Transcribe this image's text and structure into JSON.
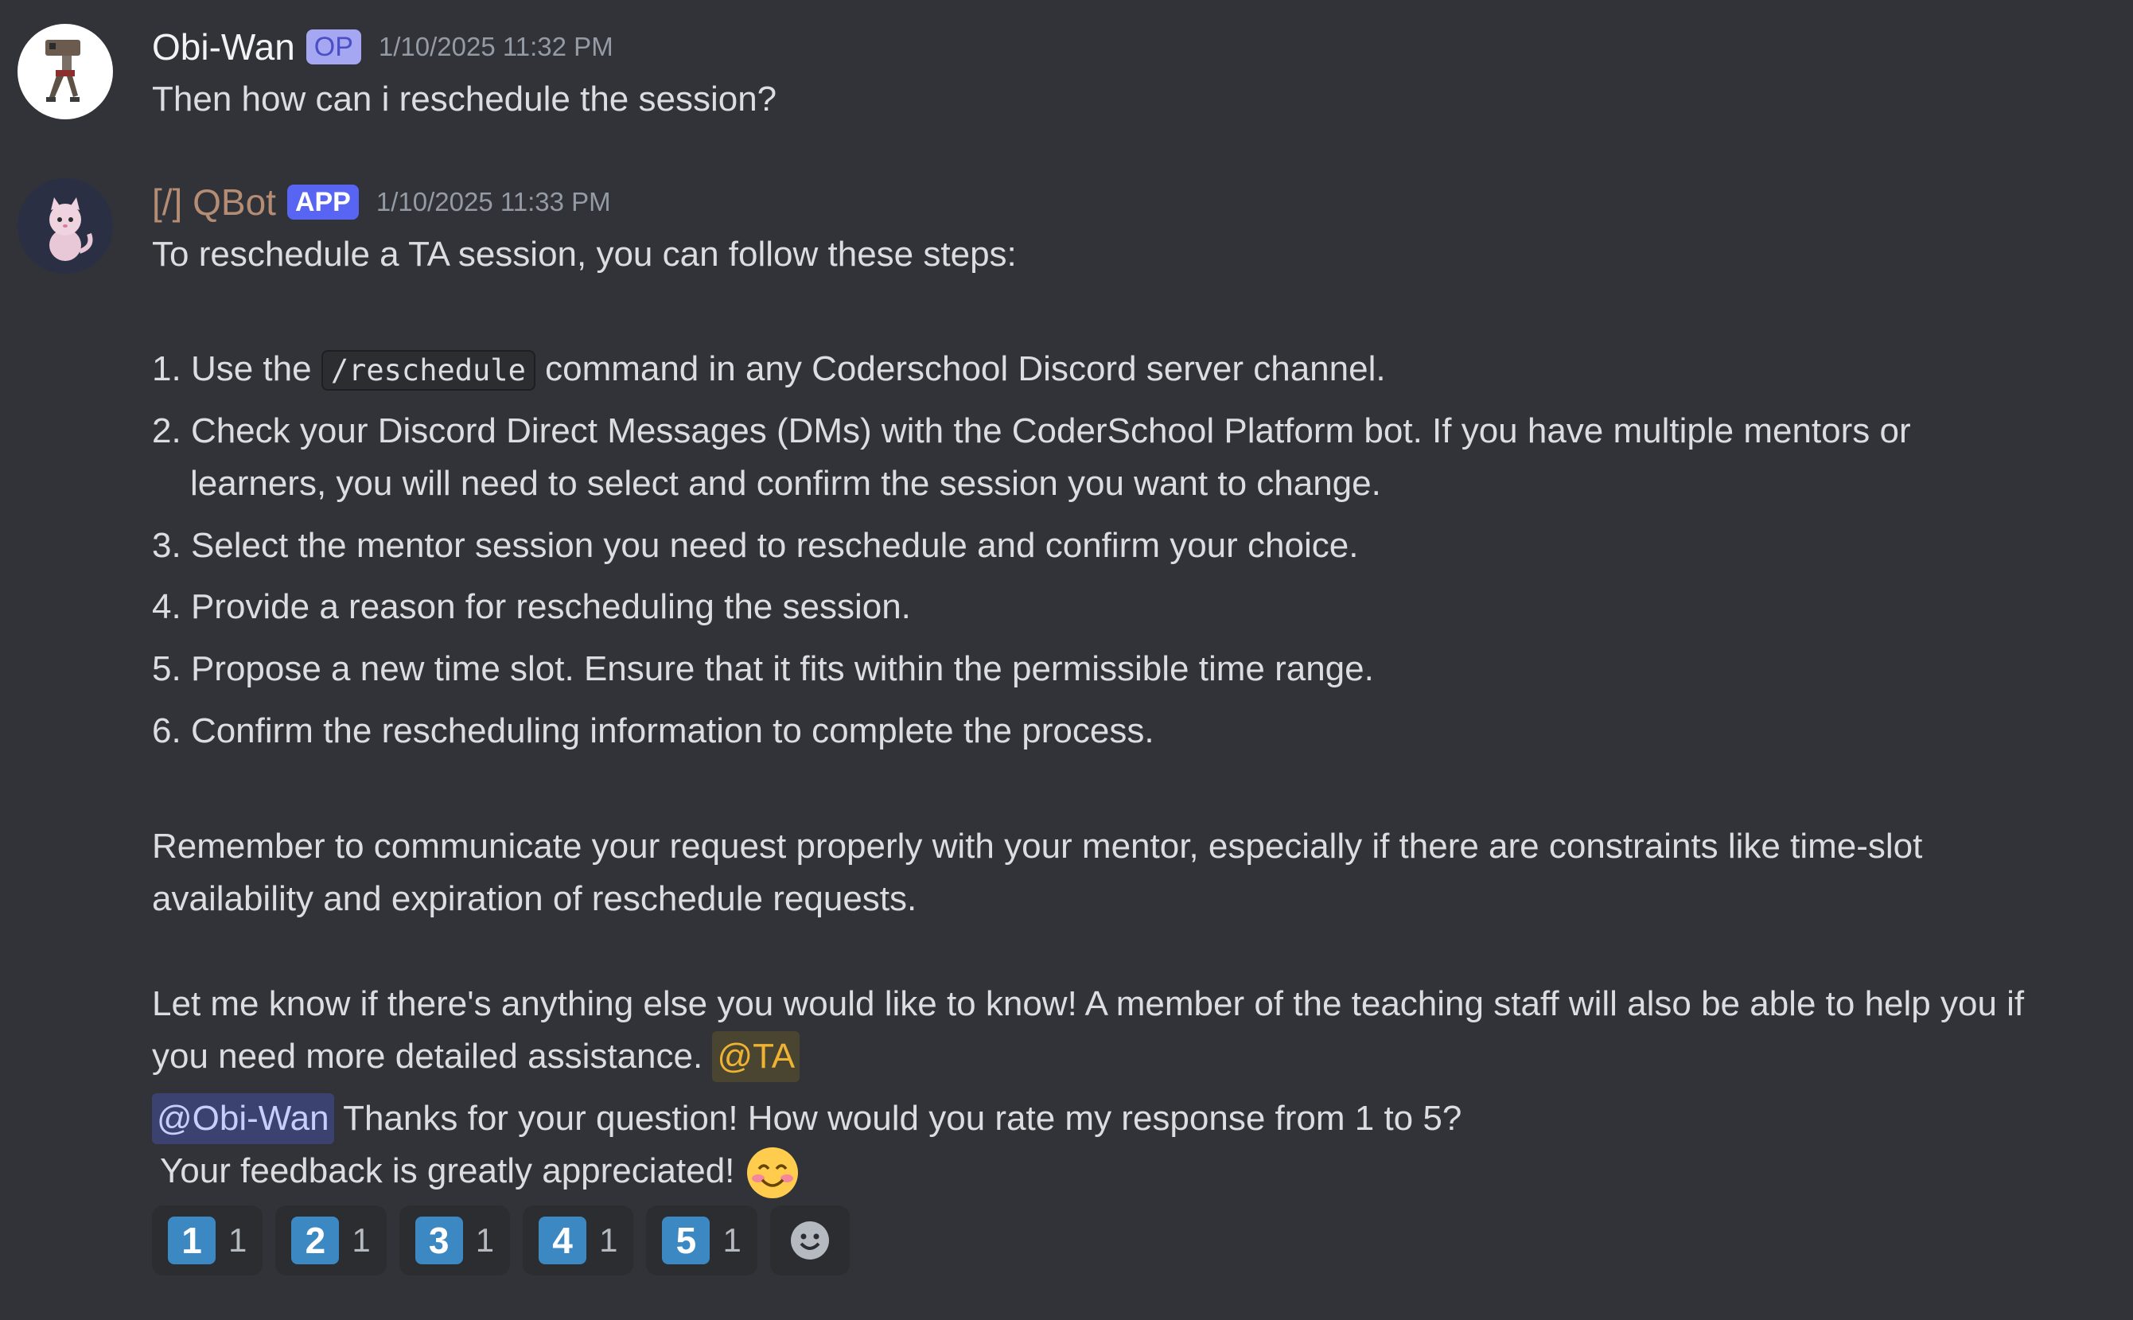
{
  "messages": [
    {
      "username": "Obi-Wan",
      "badge": "OP",
      "timestamp": "1/10/2025 11:32 PM",
      "text": "Then how can i reschedule the session?"
    },
    {
      "username": "[/] QBot",
      "badge": "APP",
      "timestamp": "1/10/2025 11:33 PM",
      "intro": "To reschedule a TA session, you can follow these steps:",
      "steps": [
        {
          "num": "1.",
          "before": "Use the",
          "code": "/reschedule",
          "after": "command in any Coderschool Discord server channel."
        },
        {
          "num": "2.",
          "line1": "Check your Discord Direct Messages (DMs) with the CoderSchool Platform bot. If you have multiple mentors or",
          "line2": "learners, you will need to select and confirm the session you want to change."
        },
        {
          "num": "3.",
          "text": "Select the mentor session you need to reschedule and confirm your choice."
        },
        {
          "num": "4.",
          "text": "Provide a reason for rescheduling the session."
        },
        {
          "num": "5.",
          "text": "Propose a new time slot. Ensure that it fits within the permissible time range."
        },
        {
          "num": "6.",
          "text": "Confirm the rescheduling information to complete the process."
        }
      ],
      "remember_line1": "Remember to communicate your request properly with your mentor, especially if there are constraints like time-slot",
      "remember_line2": "availability and expiration of reschedule requests.",
      "letme_line1": "Let me know if there's anything else you would like to know! A member of the teaching staff will also be able to help you if",
      "letme_line2": "you need more detailed assistance.",
      "role_mention": "@TA",
      "user_mention": "@Obi-Wan",
      "thanks": "Thanks for your question! How would you rate my response from 1 to 5?",
      "feedback": "Your feedback is greatly appreciated!",
      "feedback_emoji": "smiling-face-with-blush-icon"
    }
  ],
  "reactions": [
    {
      "emoji": "1",
      "count": "1"
    },
    {
      "emoji": "2",
      "count": "1"
    },
    {
      "emoji": "3",
      "count": "1"
    },
    {
      "emoji": "4",
      "count": "1"
    },
    {
      "emoji": "5",
      "count": "1"
    }
  ],
  "add_reaction_icon": "add-reaction-smiley-icon",
  "colors": {
    "background": "#313338",
    "keycap": "#3b88c3",
    "bot_name": "#b58c74",
    "app_badge": "#5865f2",
    "role_mention": "#f0b232"
  }
}
